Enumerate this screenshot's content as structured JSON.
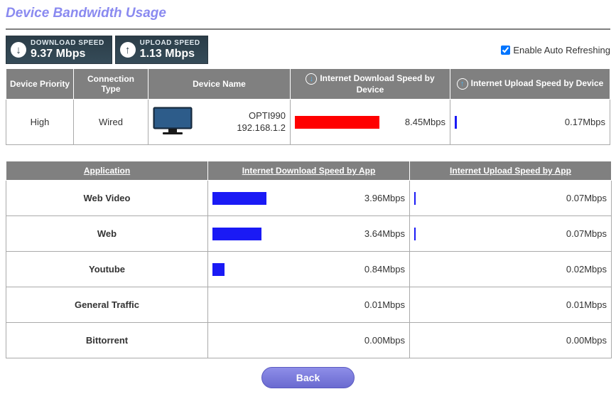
{
  "title": "Device Bandwidth Usage",
  "speeds": {
    "download_label": "DOWNLOAD SPEED",
    "download_value": "9.37 Mbps",
    "upload_label": "UPLOAD SPEED",
    "upload_value": "1.13 Mbps"
  },
  "auto_refresh": {
    "label": "Enable Auto Refreshing",
    "checked": true
  },
  "device_headers": {
    "priority": "Device Priority",
    "conn_type": "Connection Type",
    "name": "Device Name",
    "dl": "Internet Download Speed by Device",
    "ul": "Internet Upload Speed by Device"
  },
  "device": {
    "priority": "High",
    "conn_type": "Wired",
    "name": "OPTI990",
    "ip": "192.168.1.2",
    "dl_value": "8.45Mbps",
    "dl_pct": 90,
    "dl_color": "#ff0000",
    "ul_value": "0.17Mbps",
    "ul_pct": 2,
    "ul_color": "#1a1af5"
  },
  "app_headers": {
    "app": "Application",
    "dl": "Internet Download Speed by App",
    "ul": "Internet Upload Speed by App"
  },
  "apps": [
    {
      "name": "Web Video",
      "dl_value": "3.96Mbps",
      "dl_pct": 40,
      "dl_color": "#1a1af5",
      "ul_value": "0.07Mbps",
      "ul_pct": 1,
      "ul_color": "#1a1af5"
    },
    {
      "name": "Web",
      "dl_value": "3.64Mbps",
      "dl_pct": 36,
      "dl_color": "#1a1af5",
      "ul_value": "0.07Mbps",
      "ul_pct": 1,
      "ul_color": "#1a1af5"
    },
    {
      "name": "Youtube",
      "dl_value": "0.84Mbps",
      "dl_pct": 9,
      "dl_color": "#1a1af5",
      "ul_value": "0.02Mbps",
      "ul_pct": 0,
      "ul_color": "#1a1af5"
    },
    {
      "name": "General Traffic",
      "dl_value": "0.01Mbps",
      "dl_pct": 0,
      "dl_color": "#1a1af5",
      "ul_value": "0.01Mbps",
      "ul_pct": 0,
      "ul_color": "#1a1af5"
    },
    {
      "name": "Bittorrent",
      "dl_value": "0.00Mbps",
      "dl_pct": 0,
      "dl_color": "#1a1af5",
      "ul_value": "0.00Mbps",
      "ul_pct": 0,
      "ul_color": "#1a1af5"
    }
  ],
  "buttons": {
    "back": "Back"
  },
  "chart_data": {
    "type": "bar",
    "title": "Device Bandwidth Usage",
    "device": {
      "download_mbps": 8.45,
      "upload_mbps": 0.17
    },
    "applications": {
      "categories": [
        "Web Video",
        "Web",
        "Youtube",
        "General Traffic",
        "Bittorrent"
      ],
      "series": [
        {
          "name": "Internet Download Speed by App (Mbps)",
          "values": [
            3.96,
            3.64,
            0.84,
            0.01,
            0.0
          ]
        },
        {
          "name": "Internet Upload Speed by App (Mbps)",
          "values": [
            0.07,
            0.07,
            0.02,
            0.01,
            0.0
          ]
        }
      ]
    }
  }
}
